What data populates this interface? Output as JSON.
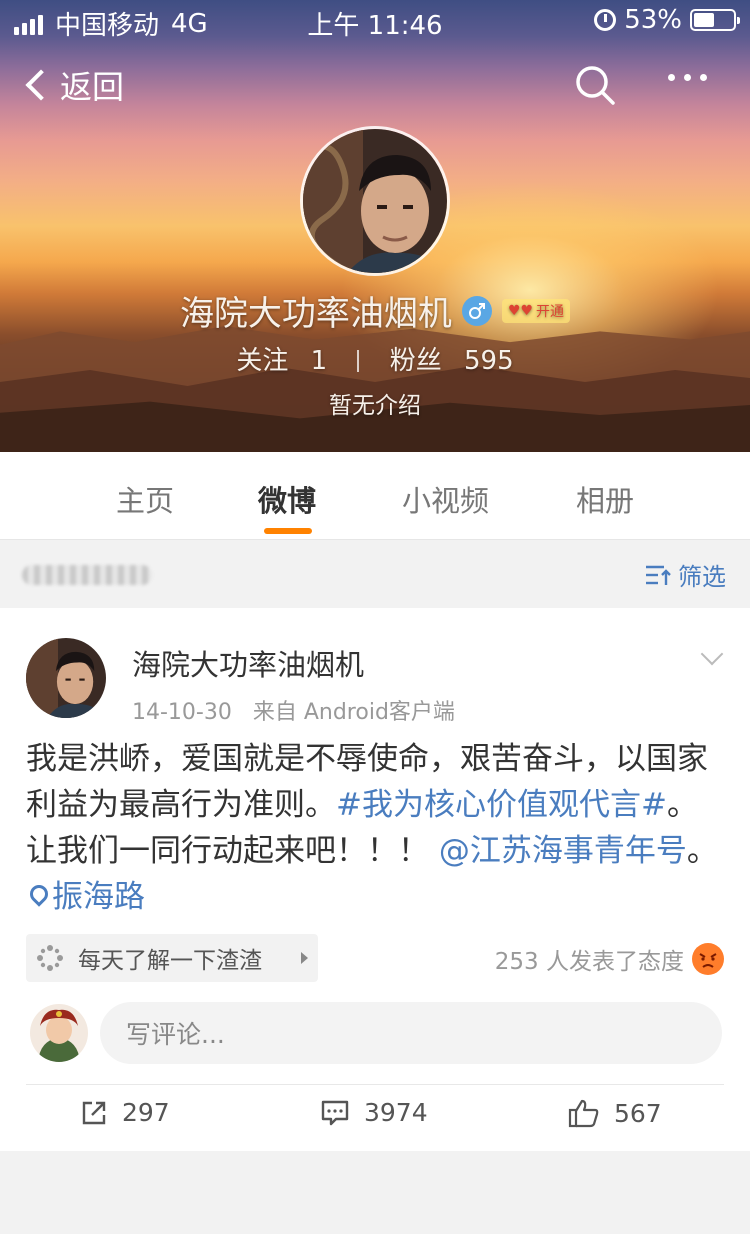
{
  "status_bar": {
    "carrier": "中国移动",
    "network": "4G",
    "time": "上午 11:46",
    "battery_percent": "53%",
    "battery_level": 0.53
  },
  "nav": {
    "back_label": "返回",
    "search_icon": "search-icon",
    "more_icon": "more-icon"
  },
  "profile": {
    "name": "海院大功率油烟机",
    "vip_badge": "开通",
    "following_label": "关注",
    "following_count": "1",
    "followers_label": "粉丝",
    "followers_count": "595",
    "bio": "暂无介绍"
  },
  "tabs": [
    {
      "label": "主页"
    },
    {
      "label": "微博"
    },
    {
      "label": "小视频"
    },
    {
      "label": "相册"
    }
  ],
  "active_tab": "微博",
  "filter": {
    "label": "筛选"
  },
  "post": {
    "author": "海院大功率油烟机",
    "date": "14-10-30",
    "source": "来自 Android客户端",
    "text_1": "我是洪峤，爱国就是不辱使命，艰苦奋斗，以国家利益为最高行为准则。",
    "hashtag": "#我为核心价值观代言#",
    "text_2": "。让我们一同行动起来吧！！！",
    "mention": "@江苏海事青年号",
    "text_3": "。",
    "location": "振海路",
    "topic": "每天了解一下渣渣",
    "reactions_text": "253 人发表了态度",
    "comment_placeholder": "写评论...",
    "reposts": "297",
    "comments": "3974",
    "likes": "567"
  },
  "colors": {
    "accent_orange": "#ff8200",
    "link_blue": "#4a7dbf",
    "gender_blue": "#5aa7e4"
  }
}
